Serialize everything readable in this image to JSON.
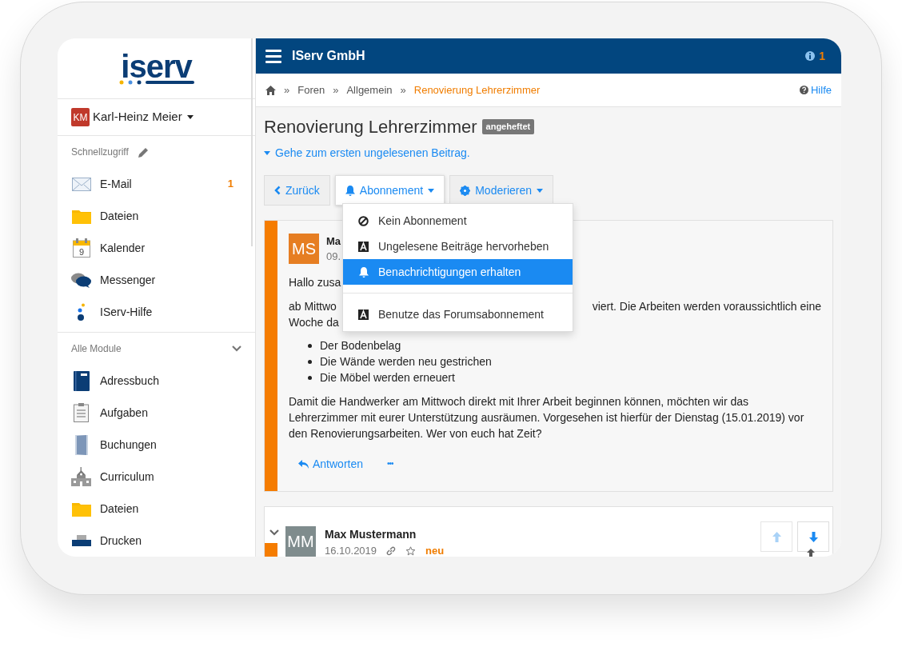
{
  "logo": {
    "text": "iserv"
  },
  "user": {
    "initials": "KM",
    "name": "Karl-Heinz Meier"
  },
  "quick_access": {
    "title": "Schnellzugriff",
    "items": [
      {
        "kind": "mail",
        "label": "E-Mail",
        "badge": "1"
      },
      {
        "kind": "folder",
        "label": "Dateien"
      },
      {
        "kind": "calendar",
        "label": "Kalender",
        "icon_digit": "9"
      },
      {
        "kind": "chat",
        "label": "Messenger"
      },
      {
        "kind": "help",
        "label": "IServ-Hilfe"
      }
    ]
  },
  "all_modules": {
    "title": "Alle Module",
    "expanded": true,
    "items": [
      {
        "kind": "book",
        "label": "Adressbuch"
      },
      {
        "kind": "clipboard",
        "label": "Aufgaben"
      },
      {
        "kind": "door",
        "label": "Buchungen"
      },
      {
        "kind": "school",
        "label": "Curriculum"
      },
      {
        "kind": "folder",
        "label": "Dateien"
      },
      {
        "kind": "printer",
        "label": "Drucken"
      }
    ]
  },
  "header": {
    "title": "IServ GmbH",
    "notification_count": "1"
  },
  "breadcrumb": {
    "separator": "»",
    "items": [
      {
        "label": "Foren",
        "current": false
      },
      {
        "label": "Allgemein",
        "current": false
      },
      {
        "label": "Renovierung Lehrerzimmer",
        "current": true
      }
    ],
    "help": "Hilfe"
  },
  "page": {
    "title": "Renovierung Lehrerzimmer",
    "badge": "angeheftet",
    "unread_link": "Gehe zum ersten ungelesenen Beitrag."
  },
  "toolbar": [
    {
      "kind": "back",
      "label": "Zurück",
      "open": false
    },
    {
      "kind": "bell",
      "label": "Abonnement",
      "open": true
    },
    {
      "kind": "gear",
      "label": "Moderieren",
      "open": false
    }
  ],
  "subscription_menu": {
    "groups": [
      [
        {
          "kind": "ban",
          "label": "Kein Abonnement",
          "selected": false
        },
        {
          "kind": "font",
          "label": "Ungelesene Beiträge hervorheben",
          "selected": false
        },
        {
          "kind": "bell",
          "label": "Benachrichtigungen erhalten",
          "selected": true
        }
      ],
      [
        {
          "kind": "font",
          "label": "Benutze das Forumsabonnement",
          "selected": false
        }
      ]
    ]
  },
  "posts": [
    {
      "initials": "MS",
      "color": "#e67e22",
      "author": "Ma",
      "date": "09.",
      "greeting": "Hallo zusa",
      "line_1_left": "ab Mittwo",
      "line_1_right": "viert. Die Arbeiten werden voraussichtlich eine",
      "line_2": "Woche da",
      "bullets": [
        "Der Bodenbelag",
        "Die Wände werden neu gestrichen",
        "Die Möbel werden erneuert"
      ],
      "closing": "Damit die Handwerker am Mittwoch direkt mit Ihrer Arbeit beginnen können, möchten wir das Lehrerzimmer mit eurer Unterstützung ausräumen. Vorgesehen ist hierfür der Dienstag (15.01.2019) vor den Renovierungsarbeiten. Wer von euch hat Zeit?",
      "reply": "Antworten",
      "more": "•••"
    },
    {
      "initials": "MM",
      "color": "#7f8c8d",
      "author": "Max Mustermann",
      "date": "16.10.2019",
      "new_label": "neu"
    }
  ]
}
